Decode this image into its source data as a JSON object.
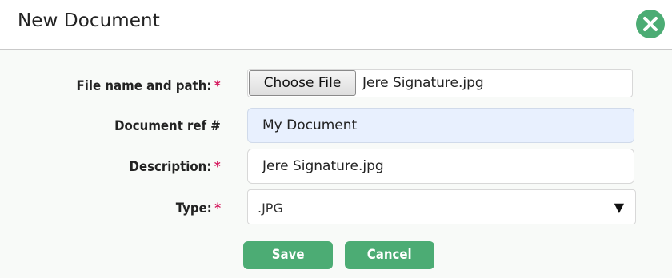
{
  "dialog": {
    "title": "New Document",
    "close_icon": "close-x-icon",
    "accent_color": "#4cac74",
    "required_color": "#d4145a"
  },
  "form": {
    "file": {
      "label": "File name and path:",
      "required_mark": "*",
      "button_label": "Choose File",
      "file_name": "Jere Signature.jpg"
    },
    "docref": {
      "label": "Document ref #",
      "value": "My Document",
      "fill_color": "#e8f0fe"
    },
    "description": {
      "label": "Description:",
      "required_mark": "*",
      "value": "Jere Signature.jpg"
    },
    "type": {
      "label": "Type:",
      "required_mark": "*",
      "selected": ".JPG",
      "arrow_glyph": "▼"
    }
  },
  "actions": {
    "save_label": "Save",
    "cancel_label": "Cancel"
  }
}
